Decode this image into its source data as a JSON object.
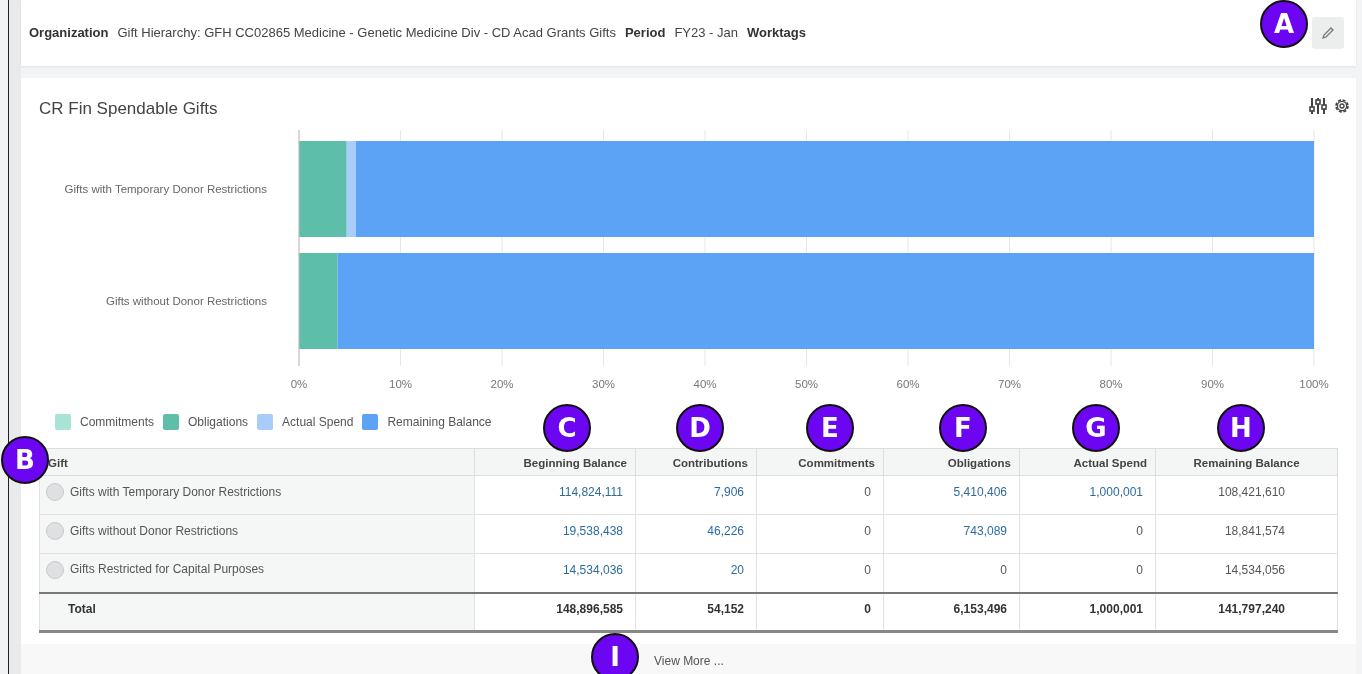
{
  "filters": [
    {
      "label": "Organization",
      "value": "Gift Hierarchy: GFH CC02865 Medicine - Genetic Medicine Div - CD Acad Grants Gifts"
    },
    {
      "label": "Period",
      "value": "FY23 - Jan"
    },
    {
      "label": "Worktags"
    }
  ],
  "report": {
    "title": "CR Fin Spendable Gifts",
    "chart_data": {
      "type": "bar",
      "orientation": "horizontal",
      "stacked": true,
      "categories": [
        "Gifts with Temporary Donor Restrictions",
        "Gifts without Donor Restrictions"
      ],
      "series": [
        {
          "name": "Commitments",
          "color": "#a8e3d6",
          "values": [
            0,
            0
          ]
        },
        {
          "name": "Obligations",
          "color": "#5dbfaa",
          "values": [
            4.7,
            3.8
          ]
        },
        {
          "name": "Actual Spend",
          "color": "#a9cdfb",
          "values": [
            0.9,
            0
          ]
        },
        {
          "name": "Remaining Balance",
          "color": "#5ca3f6",
          "values": [
            94.4,
            96.2
          ]
        }
      ],
      "xlim": [
        0,
        100
      ],
      "grid": true,
      "xticks": [
        {
          "value": 0,
          "label": "0%"
        },
        {
          "value": 10,
          "label": "10%"
        },
        {
          "value": 20,
          "label": "20%"
        },
        {
          "value": 30,
          "label": "30%"
        },
        {
          "value": 40,
          "label": "40%"
        },
        {
          "value": 50,
          "label": "50%"
        },
        {
          "value": 60,
          "label": "60%"
        },
        {
          "value": 70,
          "label": "70%"
        },
        {
          "value": 80,
          "label": "80%"
        },
        {
          "value": 90,
          "label": "90%"
        },
        {
          "value": 100,
          "label": "100%"
        }
      ]
    }
  },
  "table": {
    "columns": [
      "Gift",
      "Beginning Balance",
      "Contributions",
      "Commitments",
      "Obligations",
      "Actual Spend",
      "Remaining Balance"
    ],
    "rows": [
      {
        "cells": [
          {
            "text": "Gifts with Temporary Donor Restrictions"
          },
          {
            "text": "114,824,111",
            "link": true
          },
          {
            "text": "7,906",
            "link": true
          },
          {
            "text": "0",
            "link": false
          },
          {
            "text": "5,410,406",
            "link": true
          },
          {
            "text": "1,000,001",
            "link": true
          },
          {
            "text": "108,421,610",
            "link": false
          }
        ]
      },
      {
        "cells": [
          {
            "text": "Gifts without Donor Restrictions"
          },
          {
            "text": "19,538,438",
            "link": true
          },
          {
            "text": "46,226",
            "link": true
          },
          {
            "text": "0",
            "link": false
          },
          {
            "text": "743,089",
            "link": true
          },
          {
            "text": "0",
            "link": false
          },
          {
            "text": "18,841,574",
            "link": false
          }
        ]
      },
      {
        "cells": [
          {
            "text": "Gifts Restricted for Capital Purposes"
          },
          {
            "text": "14,534,036",
            "link": true
          },
          {
            "text": "20",
            "link": true
          },
          {
            "text": "0",
            "link": false
          },
          {
            "text": "0",
            "link": false
          },
          {
            "text": "0",
            "link": false
          },
          {
            "text": "14,534,056",
            "link": false
          }
        ]
      }
    ],
    "total": [
      "Total",
      "148,896,585",
      "54,152",
      "0",
      "6,153,496",
      "1,000,001",
      "141,797,240"
    ]
  },
  "view_more": "View More ...",
  "callouts": [
    "A",
    "B",
    "C",
    "D",
    "E",
    "F",
    "G",
    "H",
    "I"
  ]
}
